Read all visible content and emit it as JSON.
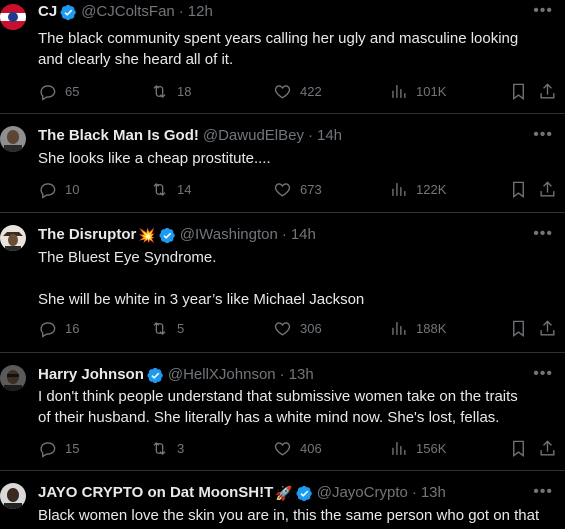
{
  "tweets": [
    {
      "name": "CJ",
      "verified": true,
      "emoji": "",
      "handle": "@CJColtsFan",
      "time": "12h",
      "text": "The black community spent years calling her ugly and masculine looking\nand clearly she heard all of it.",
      "replies": "65",
      "retweets": "18",
      "likes": "422",
      "views": "101K",
      "avatar_color": "#c8102e"
    },
    {
      "name": "The Black Man Is God!",
      "verified": false,
      "emoji": "",
      "handle": "@DawudElBey",
      "time": "14h",
      "text": "She looks like a cheap prostitute....",
      "replies": "10",
      "retweets": "14",
      "likes": "673",
      "views": "122K",
      "avatar_color": "#6b5a4c"
    },
    {
      "name": "The Disruptor",
      "verified": true,
      "emoji": "💥",
      "handle": "@IWashington",
      "time": "14h",
      "text": "The Bluest Eye Syndrome.\n\nShe will be white in 3 year’s like Michael Jackson",
      "replies": "16",
      "retweets": "5",
      "likes": "306",
      "views": "188K",
      "avatar_color": "#8a7a5c"
    },
    {
      "name": "Harry Johnson",
      "verified": true,
      "emoji": "",
      "handle": "@HellXJohnson",
      "time": "13h",
      "text": "I don't think people understand that submissive women take on the traits\nof their husband. She literally has a white mind now. She's lost, fellas.",
      "replies": "15",
      "retweets": "3",
      "likes": "406",
      "views": "156K",
      "avatar_color": "#4a4a4a"
    },
    {
      "name": "JAYO CRYPTO on Dat MoonSH!T",
      "verified": true,
      "emoji": "🚀",
      "handle": "@JayoCrypto",
      "time": "13h",
      "text": "Black women love the skin you are in, this the same person who got on that",
      "replies": "",
      "retweets": "",
      "likes": "",
      "views": "",
      "avatar_color": "#3a3a3a"
    }
  ],
  "colors": {
    "background": "#000000",
    "text": "#e7e9ea",
    "secondary": "#71767b",
    "verified": "#1d9bf0",
    "divider": "#2f3336"
  }
}
